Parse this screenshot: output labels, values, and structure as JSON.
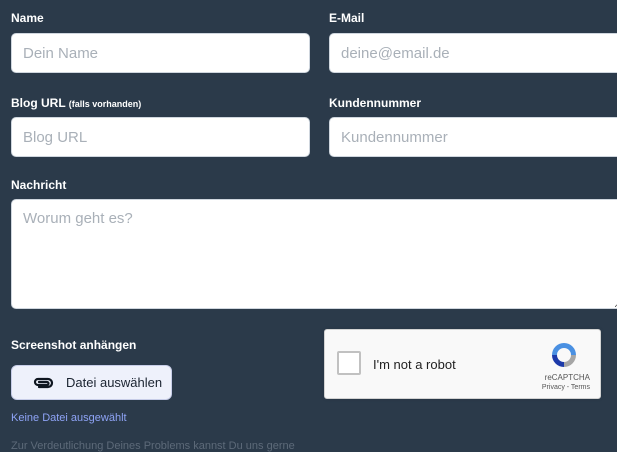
{
  "form": {
    "name": {
      "label": "Name",
      "placeholder": "Dein Name",
      "value": ""
    },
    "email": {
      "label": "E-Mail",
      "placeholder": "deine@email.de",
      "value": ""
    },
    "blog_url": {
      "label": "Blog URL",
      "label_note": "(falls vorhanden)",
      "placeholder": "Blog URL",
      "value": ""
    },
    "customer_number": {
      "label": "Kundennummer",
      "placeholder": "Kundennummer",
      "value": ""
    },
    "message": {
      "label": "Nachricht",
      "placeholder": "Worum geht es?",
      "value": ""
    },
    "screenshot": {
      "label": "Screenshot anhängen",
      "button_label": "Datei auswählen",
      "status_text": "Keine Datei ausgewählt",
      "hint_text": "Zur Verdeutlichung Deines Problems kannst Du uns gerne"
    }
  },
  "recaptcha": {
    "checkbox_label": "I'm not a robot",
    "brand": "reCAPTCHA",
    "links": "Privacy - Terms"
  },
  "icons": {
    "attach": "paperclip-icon",
    "captcha_logo": "recaptcha-logo-icon",
    "resize": "resize-handle-icon"
  },
  "colors": {
    "background": "#2b3a4a",
    "link": "#8ea3f5",
    "button_bg": "#eef1fb"
  }
}
